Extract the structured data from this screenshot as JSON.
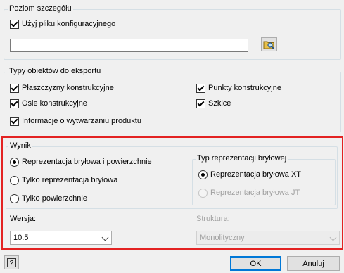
{
  "detail_level": {
    "legend": "Poziom szczegółu",
    "use_config_file": {
      "label": "Użyj pliku konfiguracyjnego",
      "checked": true
    },
    "config_path": {
      "value": ""
    },
    "browse_icon": "browse-folder-icon"
  },
  "export_types": {
    "legend": "Typy obiektów do eksportu",
    "items": [
      {
        "label": "Płaszczyzny konstrukcyjne",
        "checked": true
      },
      {
        "label": "Punkty konstrukcyjne",
        "checked": true
      },
      {
        "label": "Osie konstrukcyjne",
        "checked": true
      },
      {
        "label": "Szkice",
        "checked": true
      },
      {
        "label": "Informacje o wytwarzaniu produktu",
        "checked": true
      }
    ]
  },
  "output": {
    "legend": "Wynik",
    "options": [
      {
        "label": "Reprezentacja bryłowa i powierzchnie",
        "selected": true
      },
      {
        "label": "Tylko reprezentacja bryłowa",
        "selected": false
      },
      {
        "label": "Tylko powierzchnie",
        "selected": false
      }
    ],
    "solid_rep": {
      "legend": "Typ reprezentacji bryłowej",
      "options": [
        {
          "label": "Reprezentacja bryłowa XT",
          "selected": true,
          "enabled": true
        },
        {
          "label": "Reprezentacja bryłowa JT",
          "selected": false,
          "enabled": false
        }
      ]
    },
    "version": {
      "label": "Wersja:",
      "value": "10.5"
    },
    "structure": {
      "label": "Struktura:",
      "value": "Monolityczny",
      "enabled": false
    },
    "highlight_color": "#e32222"
  },
  "footer": {
    "help_label": "?",
    "ok_label": "OK",
    "cancel_label": "Anuluj"
  }
}
